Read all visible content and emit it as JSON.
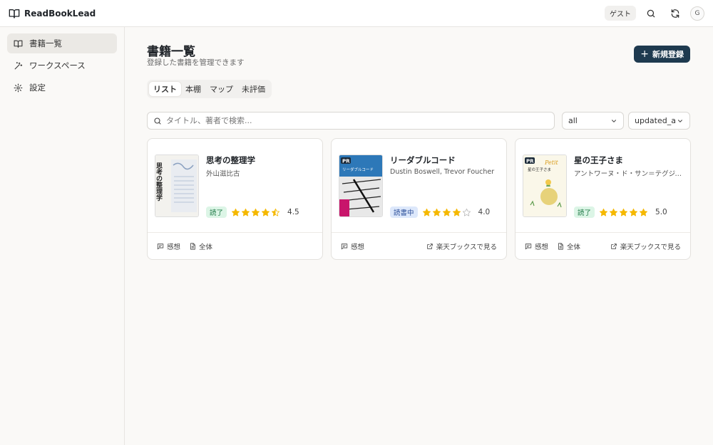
{
  "app": {
    "name": "ReadBookLead"
  },
  "header": {
    "guest_label": "ゲスト",
    "avatar_initial": "G"
  },
  "sidebar": {
    "items": [
      {
        "label": "書籍一覧",
        "icon": "book-open-icon",
        "active": true
      },
      {
        "label": "ワークスペース",
        "icon": "magic-wand-icon",
        "active": false
      },
      {
        "label": "設定",
        "icon": "gear-icon",
        "active": false
      }
    ]
  },
  "main": {
    "title": "書籍一覧",
    "subtitle": "登録した書籍を管理できます",
    "new_button": "新規登録",
    "tabs": [
      "リスト",
      "本棚",
      "マップ",
      "未評価"
    ],
    "active_tab": 0,
    "search": {
      "placeholder": "タイトル、著者で検索...",
      "value": ""
    },
    "filter": {
      "value": "all"
    },
    "sort": {
      "value": "updated_a"
    }
  },
  "books": [
    {
      "title": "思考の整理学",
      "author": "外山滋比古",
      "cover_text": "思考の整理学",
      "status": "読了",
      "status_type": "done",
      "rating": 4.5,
      "rating_text": "4.5",
      "stars_fill": [
        1,
        1,
        1,
        1,
        0.5
      ],
      "links": [
        "感想",
        "全体"
      ],
      "right_link": ""
    },
    {
      "title": "リーダブルコード",
      "author": "Dustin Boswell, Trevor Foucher",
      "cover_text": "リーダブルコード",
      "pr_badge": "PR",
      "status": "読書中",
      "status_type": "reading",
      "rating": 4.0,
      "rating_text": "4.0",
      "stars_fill": [
        1,
        1,
        1,
        1,
        0
      ],
      "links": [
        "感想"
      ],
      "right_link": "楽天ブックスで見る"
    },
    {
      "title": "星の王子さま",
      "author": "アントワーヌ・ド・サン＝テグジュペリ",
      "cover_text": "星の王子さま",
      "pr_badge": "PR",
      "status": "読了",
      "status_type": "done",
      "rating": 5.0,
      "rating_text": "5.0",
      "stars_fill": [
        1,
        1,
        1,
        1,
        1
      ],
      "links": [
        "感想",
        "全体"
      ],
      "right_link": "楽天ブックスで見る"
    }
  ],
  "colors": {
    "accent": "#1e3a4f",
    "star": "#f5b800",
    "done_bg": "#dcf5e6",
    "reading_bg": "#dde8fb"
  }
}
